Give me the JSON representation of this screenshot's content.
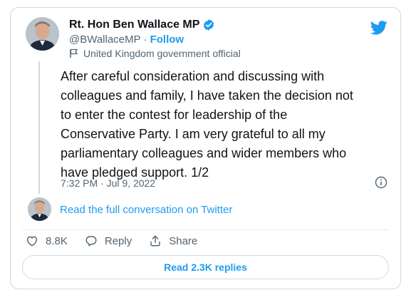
{
  "author": {
    "display_name": "Rt. Hon Ben Wallace MP",
    "handle": "@BWallaceMP",
    "separator": " · ",
    "follow_label": "Follow",
    "label": "United Kingdom government official"
  },
  "tweet": {
    "text": "After careful consideration and discussing with\ncolleagues and family, I have taken the decision not\nto enter the contest for leadership of the\nConservative Party.  I am very grateful to all my\nparliamentary colleagues and wider members who\nhave pledged support.  1/2",
    "time": "7:32 PM",
    "date_separator": " · ",
    "date": "Jul 9, 2022"
  },
  "conversation": {
    "label": "Read the full conversation on Twitter"
  },
  "actions": {
    "likes": "8.8K",
    "reply_label": "Reply",
    "share_label": "Share"
  },
  "replies_button": {
    "label": "Read 2.3K replies"
  },
  "colors": {
    "accent": "#1d9bf0",
    "text": "#0f1419",
    "muted": "#536471",
    "border": "#cfd9de"
  },
  "icons": [
    "verified-icon",
    "twitter-icon",
    "flag-icon",
    "info-icon",
    "heart-icon",
    "reply-icon",
    "share-icon"
  ]
}
